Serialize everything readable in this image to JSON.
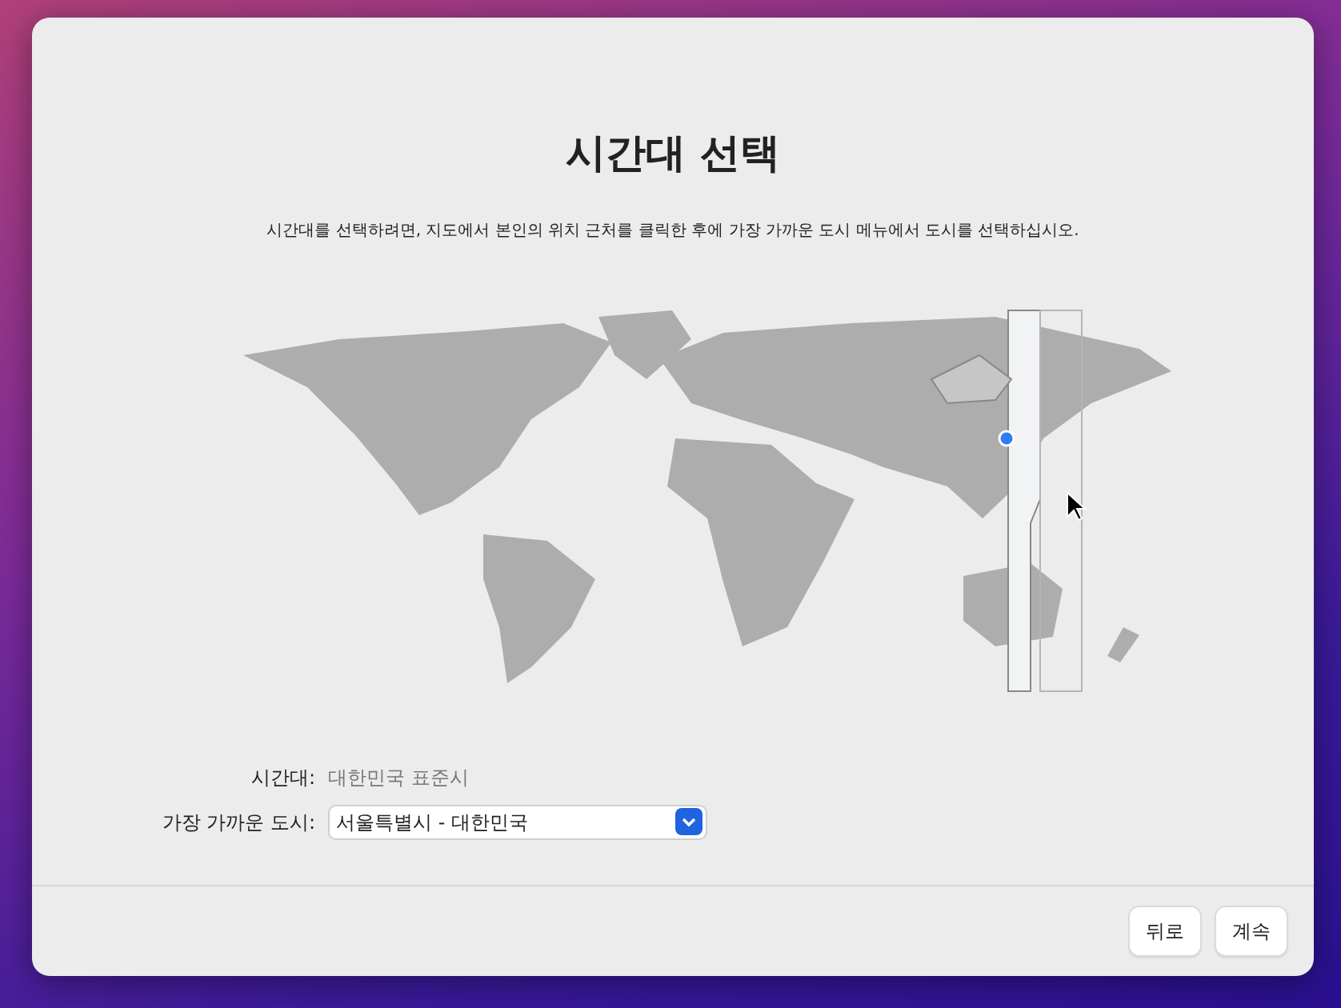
{
  "title": "시간대 선택",
  "instruction": "시간대를 선택하려면, 지도에서 본인의 위치 근처를 클릭한 후에 가장 가까운 도시 메뉴에서 도시를 선택하십시오.",
  "form": [
    {
      "kind": "text",
      "label": "시간대:",
      "value": "대한민국 표준시"
    },
    {
      "kind": "select",
      "label": "가장 가까운 도시:",
      "value": "서울특별시 - 대한민국"
    }
  ],
  "buttons": [
    "뒤로",
    "계속"
  ]
}
